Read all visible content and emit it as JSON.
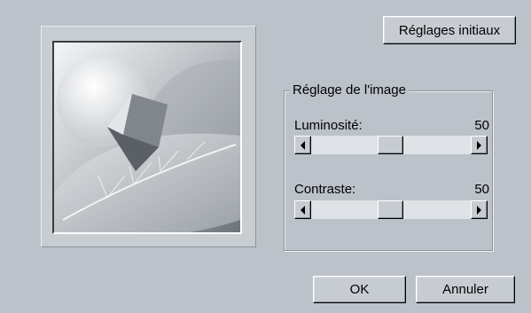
{
  "buttons": {
    "reset_label": "Réglages initiaux",
    "ok_label": "OK",
    "cancel_label": "Annuler"
  },
  "adjustment": {
    "group_title": "Réglage de l'image",
    "brightness": {
      "label": "Luminosité:",
      "value": "50"
    },
    "contrast": {
      "label": "Contraste:",
      "value": "50"
    }
  },
  "colors": {
    "dialog_bg": "#bcc2c9",
    "button_face": "#c7ccd2"
  }
}
